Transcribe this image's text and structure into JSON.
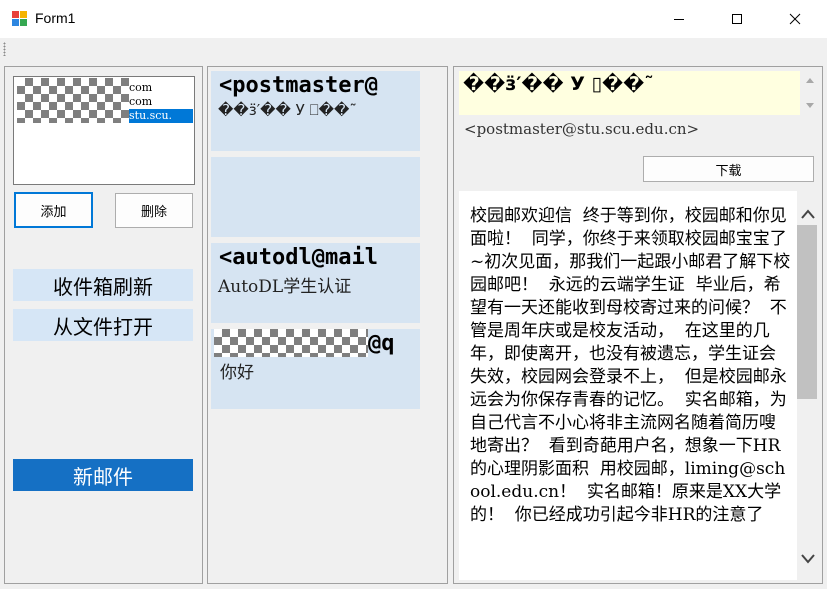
{
  "window": {
    "title": "Form1",
    "minimize_glyph": "—",
    "maximize_glyph": "☐",
    "close_glyph": "✕"
  },
  "accounts": {
    "items": [
      {
        "label": "com",
        "selected": false
      },
      {
        "label": "com",
        "selected": false
      },
      {
        "label": "stu.scu.",
        "selected": true
      }
    ]
  },
  "buttons": {
    "add": "添加",
    "delete": "删除",
    "refresh_inbox": "收件箱刷新",
    "open_from_file": "从文件打开",
    "new_mail": "新邮件",
    "download": "下载"
  },
  "mail_list": [
    {
      "from": "<postmaster@",
      "subject": "��ӟ′�� У ⎕��˜"
    },
    {
      "from": "",
      "subject": ""
    },
    {
      "from": "<autodl@mail",
      "subject": "AutoDL学生认证"
    },
    {
      "from": "@q",
      "subject": "你好"
    }
  ],
  "reader": {
    "subject": "��ӟ′�� У ▯��˜",
    "from": "<postmaster@stu.scu.edu.cn>",
    "body": "校园邮欢迎信  终于等到你，校园邮和你见面啦！  同学，你终于来领取校园邮宝宝了~初次见面，那我们一起跟小邮君了解下校园邮吧！  永远的云端学生证  毕业后，希望有一天还能收到母校寄过来的问候？  不管是周年庆或是校友活动，  在这里的几年，即使离开，也没有被遗忘，学生证会失效，校园网会登录不上，  但是校园邮永远会为你保存青春的记忆。  实名邮箱，为自己代言不小心将非主流网名随着简历嗖地寄出？  看到奇葩用户名，想象一下HR的心理阴影面积  用校园邮，liming@school.edu.cn！  实名邮箱！原来是XX大学的！  你已经成功引起今非HR的注意了"
  },
  "colors": {
    "card_bg": "#d6e4f2",
    "button_blue": "#1570c4",
    "selection": "#0078d7",
    "subject_bg": "#ffffe0"
  }
}
